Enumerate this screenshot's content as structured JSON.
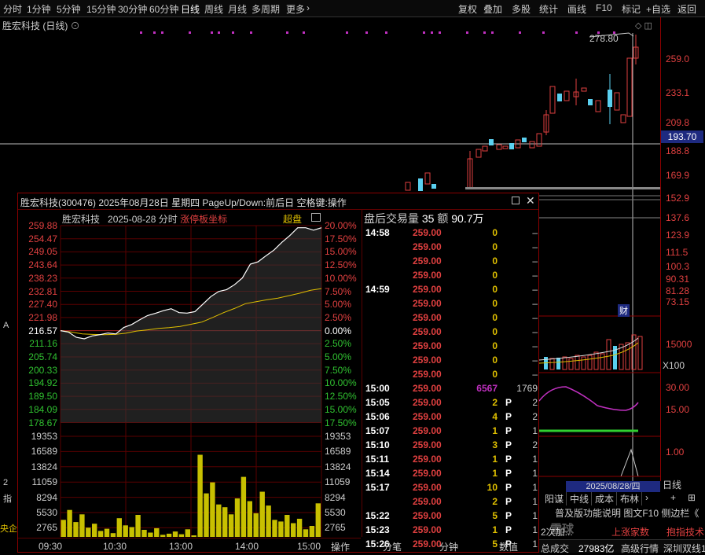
{
  "toolbar": {
    "left_tabs": [
      "分时",
      "1分钟",
      "5分钟",
      "15分钟",
      "30分钟",
      "60分钟",
      "日线",
      "周线",
      "月线",
      "多周期",
      "更多"
    ],
    "right_tabs": [
      "复权",
      "叠加",
      "多股",
      "统计",
      "画线",
      "F10",
      "标记",
      "+自选",
      "返回"
    ]
  },
  "main": {
    "title": "胜宏科技 (日线)",
    "peak_label": "278.80",
    "current_price_tag": "193.70",
    "price_ticks": [
      "259.0",
      "233.1",
      "209.8",
      "188.8",
      "169.9",
      "152.9",
      "137.6",
      "123.9",
      "111.5",
      "100.3",
      "90.31",
      "81.28",
      "73.15"
    ],
    "fin_marker": "财",
    "volume_tick": "15000",
    "volume_unit": "X100",
    "ind1_ticks": [
      "30.00",
      "15.00"
    ],
    "ind2_tick": "1.00",
    "date_label": "2025/08/28/四",
    "period_label": "日线",
    "bottom_tabs": [
      "阳谋",
      "中线",
      "成本",
      "布林"
    ],
    "icons_row": [
      "+",
      "⊞"
    ]
  },
  "popup": {
    "title": "胜宏科技(300476)  2025年08月28日  星期四  PageUp/Down:前后日  空格键:操作",
    "intraday": {
      "stock": "胜宏科技",
      "date": "2025-08-28",
      "mode": "分时",
      "coord_label": "涨停板坐标",
      "chaopan": "超盘",
      "left_prices": [
        "259.88",
        "254.47",
        "249.05",
        "243.64",
        "238.23",
        "232.81",
        "227.40",
        "221.98",
        "216.57",
        "211.16",
        "205.74",
        "200.33",
        "194.92",
        "189.50",
        "184.09",
        "178.67"
      ],
      "right_pcts": [
        "20.00%",
        "17.50%",
        "15.00%",
        "12.50%",
        "10.00%",
        "7.50%",
        "5.00%",
        "2.50%",
        "0.00%",
        "2.50%",
        "5.00%",
        "7.50%",
        "10.00%",
        "12.50%",
        "15.00%",
        "17.50%"
      ],
      "vol_labels": [
        "19353",
        "16589",
        "13824",
        "11059",
        "8294",
        "5530",
        "2765"
      ],
      "time_labels": [
        "09:30",
        "10:30",
        "13:00",
        "14:00",
        "15:00"
      ],
      "price_series": [
        216.57,
        216.0,
        213.8,
        213.2,
        214.4,
        214.9,
        215.6,
        215.2,
        217.9,
        219.1,
        221.0,
        222.8,
        223.7,
        224.8,
        225.6,
        224.0,
        223.8,
        224.4,
        227.5,
        230.6,
        232.7,
        233.5,
        235.5,
        238.3,
        244.0,
        245.0,
        247.5,
        249.8,
        253.0,
        255.8,
        259.0,
        259.0,
        258.0,
        259.0
      ],
      "avg_series": [
        216.57,
        216.0,
        215.2,
        215.0,
        214.9,
        215.0,
        215.5,
        216.4,
        216.9,
        217.5,
        217.8,
        218.3,
        219.2,
        220.1,
        222.0,
        224.0,
        225.7,
        227.7,
        228.5,
        229.3,
        230.0,
        231.0,
        232.0,
        233.2,
        233.9
      ],
      "volume_series": [
        4200,
        6000,
        3800,
        5200,
        2800,
        3500,
        2200,
        2600,
        1800,
        4500,
        3200,
        2900,
        5100,
        2400,
        1900,
        2700,
        1500,
        1700,
        2100,
        1600,
        2500,
        1400,
        16000,
        9000,
        11000,
        7000,
        6500,
        5200,
        8100,
        12000,
        7600,
        5400,
        9300,
        6800,
        4200,
        3900,
        5100,
        3600,
        4400,
        2500,
        3100,
        7200
      ]
    },
    "trades": {
      "header_label": "盘后交易量",
      "header_count": "35",
      "header_amt_label": "额",
      "header_amt": "90.7万",
      "rows": [
        {
          "time": "14:58",
          "price": "259.00",
          "vol": "0",
          "flag": "",
          "num": "–"
        },
        {
          "time": "",
          "price": "259.00",
          "vol": "0",
          "flag": "",
          "num": "–"
        },
        {
          "time": "",
          "price": "259.00",
          "vol": "0",
          "flag": "",
          "num": "–"
        },
        {
          "time": "",
          "price": "259.00",
          "vol": "0",
          "flag": "",
          "num": "–"
        },
        {
          "time": "14:59",
          "price": "259.00",
          "vol": "0",
          "flag": "",
          "num": "–"
        },
        {
          "time": "",
          "price": "259.00",
          "vol": "0",
          "flag": "",
          "num": "–"
        },
        {
          "time": "",
          "price": "259.00",
          "vol": "0",
          "flag": "",
          "num": "–"
        },
        {
          "time": "",
          "price": "259.00",
          "vol": "0",
          "flag": "",
          "num": "–"
        },
        {
          "time": "",
          "price": "259.00",
          "vol": "0",
          "flag": "",
          "num": "–"
        },
        {
          "time": "",
          "price": "259.00",
          "vol": "0",
          "flag": "",
          "num": "–"
        },
        {
          "time": "",
          "price": "259.00",
          "vol": "0",
          "flag": "",
          "num": "–"
        },
        {
          "time": "15:00",
          "price": "259.00",
          "vol": "6567",
          "flag": "",
          "num": "1769",
          "purple": true
        },
        {
          "time": "15:05",
          "price": "259.00",
          "vol": "2",
          "flag": "P",
          "num": "2"
        },
        {
          "time": "15:06",
          "price": "259.00",
          "vol": "4",
          "flag": "P",
          "num": "2"
        },
        {
          "time": "15:07",
          "price": "259.00",
          "vol": "1",
          "flag": "P",
          "num": "1"
        },
        {
          "time": "15:10",
          "price": "259.00",
          "vol": "3",
          "flag": "P",
          "num": "2"
        },
        {
          "time": "15:11",
          "price": "259.00",
          "vol": "1",
          "flag": "P",
          "num": "1"
        },
        {
          "time": "15:14",
          "price": "259.00",
          "vol": "1",
          "flag": "P",
          "num": "1"
        },
        {
          "time": "15:17",
          "price": "259.00",
          "vol": "10",
          "flag": "P",
          "num": "1"
        },
        {
          "time": "",
          "price": "259.00",
          "vol": "2",
          "flag": "P",
          "num": "1"
        },
        {
          "time": "15:22",
          "price": "259.00",
          "vol": "5",
          "flag": "P",
          "num": "1"
        },
        {
          "time": "15:23",
          "price": "259.00",
          "vol": "1",
          "flag": "P",
          "num": "1"
        },
        {
          "time": "15:26",
          "price": "259.00",
          "vol": "5",
          "flag": "P",
          "num": "1"
        }
      ]
    },
    "bottom_tabs": [
      "操作",
      "分笔",
      "分钟",
      "数值"
    ]
  },
  "right_bottom": {
    "func_row": "普及版功能说明  图文F10  侧边栏《",
    "ticker_a": "2次加...",
    "ticker_b": "上涨家数",
    "ticker_c": "抱指技术",
    "status_a": "总成交",
    "status_b": "27983亿",
    "status_c": "高级行情",
    "status_d": "深圳双线1"
  },
  "left_strip": [
    "A",
    "2",
    "指",
    "央企"
  ],
  "watermark": "雪球"
}
